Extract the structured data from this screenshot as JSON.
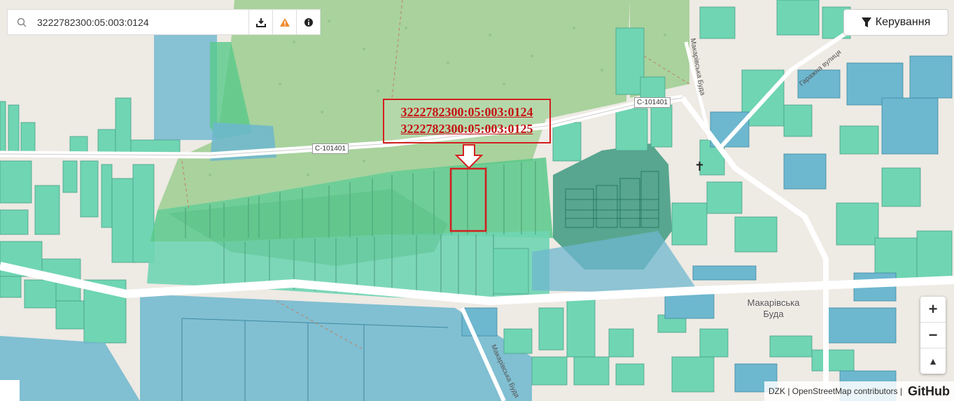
{
  "search": {
    "value": "3222782300:05:003:0124",
    "icon": "search-icon"
  },
  "toolbar": {
    "download_icon": "download-icon",
    "warning_icon": "warning-icon",
    "info_icon": "info-icon"
  },
  "control_button": {
    "label": "Керування",
    "icon": "filter-icon"
  },
  "callout": {
    "line1": "3222782300:05:003:0124",
    "line2": "3222782300:05:003:0125"
  },
  "road_labels": {
    "left": "C-101401",
    "right": "C-101401"
  },
  "place": {
    "line1": "Макарівська",
    "line2": "Буда"
  },
  "streets": {
    "garage": "Гаражна вулиця",
    "north": "Макарівська Буда",
    "south": "Макарівська Буда"
  },
  "zoom": {
    "in": "+",
    "out": "−",
    "reset_north": "▲"
  },
  "attribution": {
    "text": "DZK | OpenStreetMap contributors |",
    "brand": "GitHub"
  },
  "colors": {
    "forest": "#a9d29d",
    "parcel_teal": "#6fd5b2",
    "parcel_blue": "#6db7cf",
    "parcel_green": "#58c98a",
    "highlight": "#d32020",
    "road": "#ffffff"
  }
}
